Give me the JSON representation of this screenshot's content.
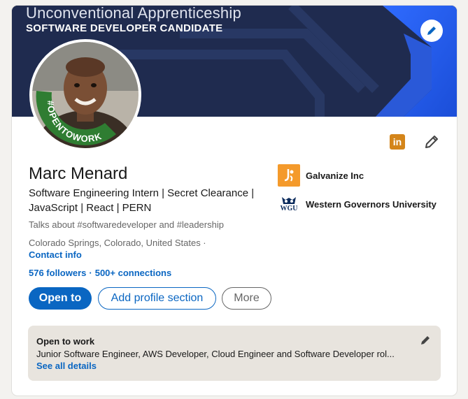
{
  "banner": {
    "line1": "Unconventional Apprenticeship",
    "line2": "SOFTWARE DEVELOPER CANDIDATE",
    "edit_icon": "pencil-icon"
  },
  "avatar": {
    "badge_text": "#OPENTOWORK",
    "ring_color": "#2f7d32"
  },
  "profile": {
    "name": "Marc Menard",
    "headline": "Software Engineering Intern | Secret Clearance | JavaScript | React | PERN",
    "talks_about": "Talks about #softwaredeveloper and #leadership",
    "location": "Colorado Springs, Colorado, United States ·",
    "contact_info": "Contact info",
    "followers": "576 followers",
    "connections": "500+ connections",
    "separator": "·",
    "linkedin_badge": "in"
  },
  "actions": {
    "open_to": "Open to",
    "add_section": "Add profile section",
    "more": "More"
  },
  "experience": [
    {
      "name": "Galvanize Inc",
      "icon": "galvanize-logo"
    },
    {
      "name": "Western Governors University",
      "icon": "wgu-logo",
      "logo_text": "WGU"
    }
  ],
  "open_to_work": {
    "title": "Open to work",
    "description": "Junior Software Engineer, AWS Developer, Cloud Engineer and Software Developer rol...",
    "link": "See all details"
  },
  "colors": {
    "accent": "#0a66c2",
    "banner_bg": "#1d2a4d",
    "galvanize": "#f49a2b",
    "linkedin_badge": "#d4851a"
  }
}
